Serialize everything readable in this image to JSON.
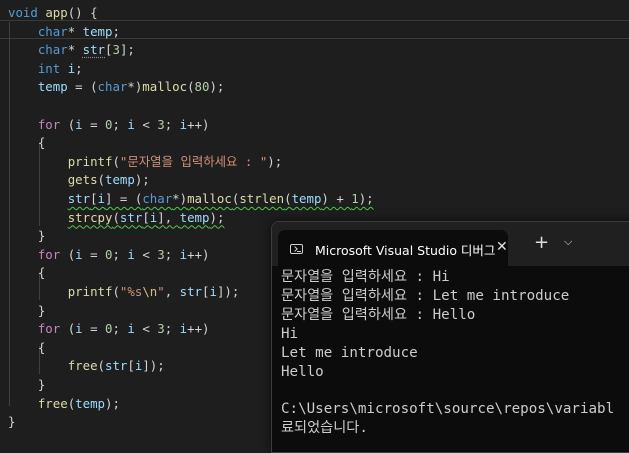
{
  "editor": {
    "lines": [
      [
        [
          "kw",
          "void"
        ],
        [
          "p",
          " "
        ],
        [
          "fn",
          "app"
        ],
        [
          "p",
          "() {"
        ]
      ],
      [
        [
          "p",
          "    "
        ],
        [
          "kw",
          "char"
        ],
        [
          "p",
          "* "
        ],
        [
          "var",
          "temp"
        ],
        [
          "p",
          ";"
        ]
      ],
      [
        [
          "p",
          "    "
        ],
        [
          "kw",
          "char"
        ],
        [
          "p",
          "* "
        ],
        [
          "var",
          "str"
        ],
        [
          "p",
          "["
        ],
        [
          "num",
          "3"
        ],
        [
          "p",
          "];"
        ]
      ],
      [
        [
          "p",
          "    "
        ],
        [
          "kw",
          "int"
        ],
        [
          "p",
          " "
        ],
        [
          "var",
          "i"
        ],
        [
          "p",
          ";"
        ]
      ],
      [
        [
          "p",
          "    "
        ],
        [
          "var",
          "temp"
        ],
        [
          "p",
          " = ("
        ],
        [
          "kw",
          "char"
        ],
        [
          "p",
          "*)"
        ],
        [
          "fn",
          "malloc"
        ],
        [
          "p",
          "("
        ],
        [
          "num",
          "80"
        ],
        [
          "p",
          ");"
        ]
      ],
      [],
      [
        [
          "p",
          "    "
        ],
        [
          "ctl",
          "for"
        ],
        [
          "p",
          " ("
        ],
        [
          "var",
          "i"
        ],
        [
          "p",
          " = "
        ],
        [
          "num",
          "0"
        ],
        [
          "p",
          "; "
        ],
        [
          "var",
          "i"
        ],
        [
          "p",
          " < "
        ],
        [
          "num",
          "3"
        ],
        [
          "p",
          "; "
        ],
        [
          "var",
          "i"
        ],
        [
          "p",
          "++)"
        ]
      ],
      [
        [
          "p",
          "    {"
        ]
      ],
      [
        [
          "p",
          "        "
        ],
        [
          "fn",
          "printf"
        ],
        [
          "p",
          "("
        ],
        [
          "str",
          "\"문자열을 입력하세요 : \""
        ],
        [
          "p",
          ");"
        ]
      ],
      [
        [
          "p",
          "        "
        ],
        [
          "fn",
          "gets"
        ],
        [
          "p",
          "("
        ],
        [
          "var",
          "temp"
        ],
        [
          "p",
          ");"
        ]
      ],
      [
        [
          "p",
          "        "
        ],
        [
          "var",
          "str"
        ],
        [
          "p",
          "["
        ],
        [
          "var",
          "i"
        ],
        [
          "p",
          "] = ("
        ],
        [
          "kw",
          "char"
        ],
        [
          "p",
          "*)"
        ],
        [
          "fn",
          "malloc"
        ],
        [
          "p",
          "("
        ],
        [
          "fn",
          "strlen"
        ],
        [
          "p",
          "("
        ],
        [
          "var",
          "temp"
        ],
        [
          "p",
          ") + "
        ],
        [
          "num",
          "1"
        ],
        [
          "p",
          ");"
        ]
      ],
      [
        [
          "p",
          "        "
        ],
        [
          "fn",
          "strcpy"
        ],
        [
          "p",
          "("
        ],
        [
          "var",
          "str"
        ],
        [
          "p",
          "["
        ],
        [
          "var",
          "i"
        ],
        [
          "p",
          "], "
        ],
        [
          "var",
          "temp"
        ],
        [
          "p",
          ");"
        ]
      ],
      [
        [
          "p",
          "    }"
        ]
      ],
      [
        [
          "p",
          "    "
        ],
        [
          "ctl",
          "for"
        ],
        [
          "p",
          " ("
        ],
        [
          "var",
          "i"
        ],
        [
          "p",
          " = "
        ],
        [
          "num",
          "0"
        ],
        [
          "p",
          "; "
        ],
        [
          "var",
          "i"
        ],
        [
          "p",
          " < "
        ],
        [
          "num",
          "3"
        ],
        [
          "p",
          "; "
        ],
        [
          "var",
          "i"
        ],
        [
          "p",
          "++)"
        ]
      ],
      [
        [
          "p",
          "    {"
        ]
      ],
      [
        [
          "p",
          "        "
        ],
        [
          "fn",
          "printf"
        ],
        [
          "p",
          "("
        ],
        [
          "str",
          "\"%s"
        ],
        [
          "esc",
          "\\n"
        ],
        [
          "str",
          "\""
        ],
        [
          "p",
          ", "
        ],
        [
          "var",
          "str"
        ],
        [
          "p",
          "["
        ],
        [
          "var",
          "i"
        ],
        [
          "p",
          "]);"
        ]
      ],
      [
        [
          "p",
          "    }"
        ]
      ],
      [
        [
          "p",
          "    "
        ],
        [
          "ctl",
          "for"
        ],
        [
          "p",
          " ("
        ],
        [
          "var",
          "i"
        ],
        [
          "p",
          " = "
        ],
        [
          "num",
          "0"
        ],
        [
          "p",
          "; "
        ],
        [
          "var",
          "i"
        ],
        [
          "p",
          " < "
        ],
        [
          "num",
          "3"
        ],
        [
          "p",
          "; "
        ],
        [
          "var",
          "i"
        ],
        [
          "p",
          "++)"
        ]
      ],
      [
        [
          "p",
          "    {"
        ]
      ],
      [
        [
          "p",
          "        "
        ],
        [
          "fn",
          "free"
        ],
        [
          "p",
          "("
        ],
        [
          "var",
          "str"
        ],
        [
          "p",
          "["
        ],
        [
          "var",
          "i"
        ],
        [
          "p",
          "]);"
        ]
      ],
      [
        [
          "p",
          "    }"
        ]
      ],
      [
        [
          "p",
          "    "
        ],
        [
          "fn",
          "free"
        ],
        [
          "p",
          "("
        ],
        [
          "var",
          "temp"
        ],
        [
          "p",
          ");"
        ]
      ],
      [
        [
          "p",
          "}"
        ]
      ]
    ],
    "colors": {
      "background": "#1e1e1e",
      "keyword": "#569cd6",
      "control": "#c586c0",
      "function": "#dcdcaa",
      "variable": "#9cdcfe",
      "number": "#b5cea8",
      "string": "#ce9178"
    }
  },
  "terminal": {
    "tab_icon": "terminal-icon",
    "tab_title": "Microsoft Visual Studio 디버그",
    "close_glyph": "✕",
    "new_tab_glyph": "+",
    "menu_glyph": "⌵",
    "lines": [
      "문자열을 입력하세요 : Hi",
      "문자열을 입력하세요 : Let me introduce",
      "문자열을 입력하세요 : Hello",
      "Hi",
      "Let me introduce",
      "Hello",
      "",
      "C:\\Users\\microsoft\\source\\repos\\variabl",
      "료되었습니다."
    ]
  }
}
